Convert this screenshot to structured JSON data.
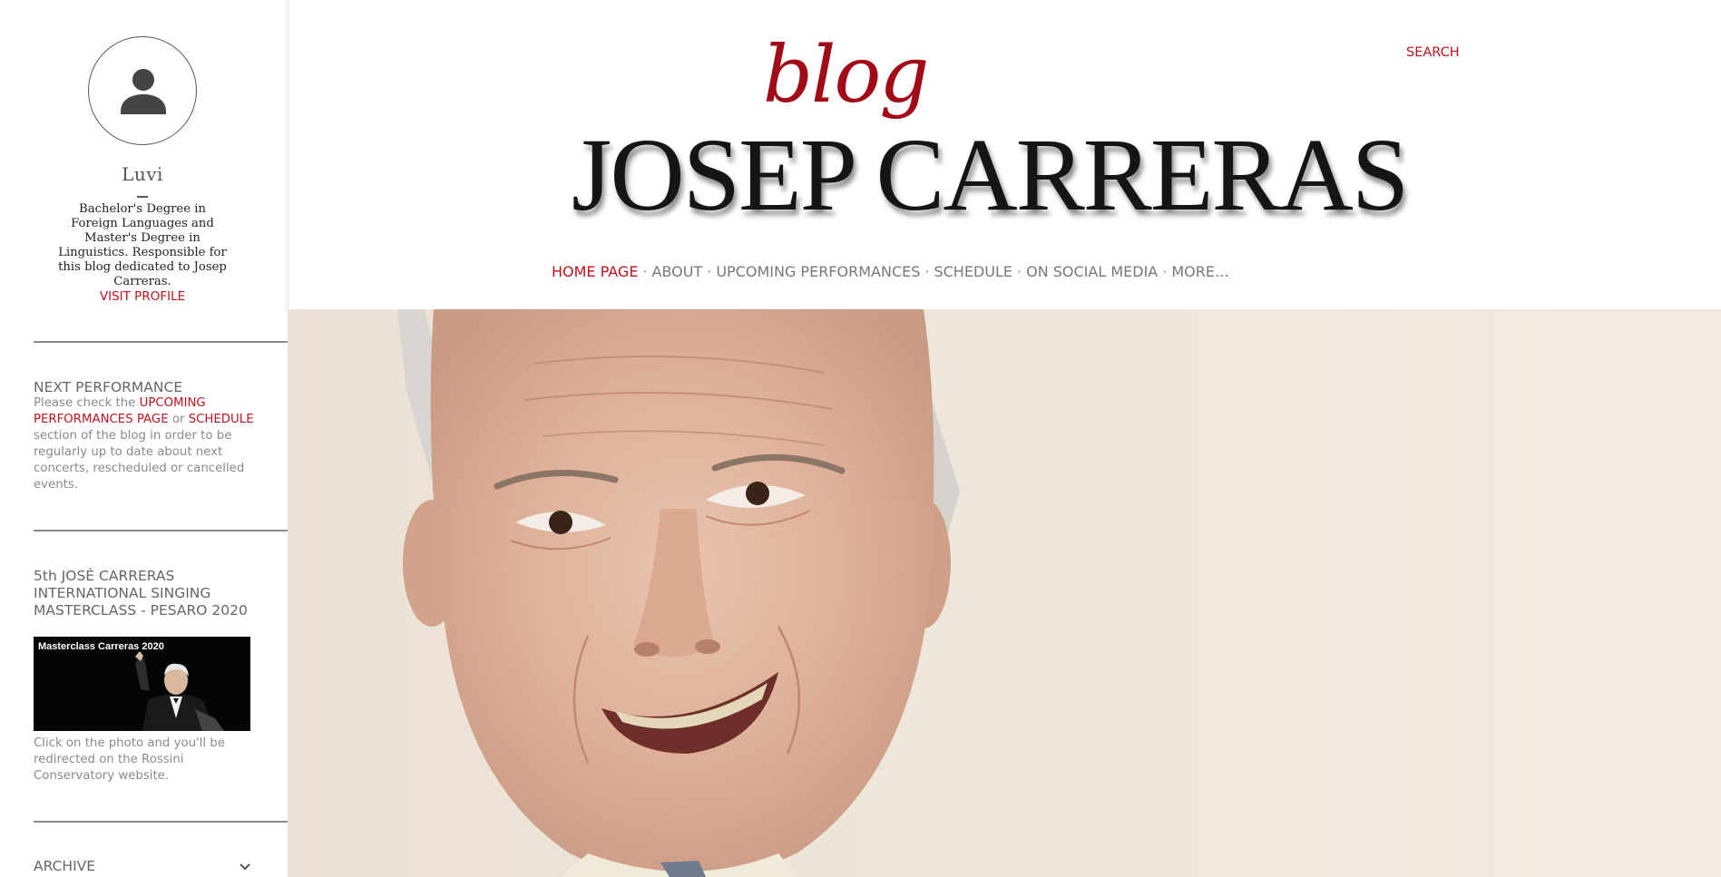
{
  "profile": {
    "name": "Luvi",
    "bio": "Bachelor's Degree in Foreign Languages and Master's Degree in Linguistics. Responsible for this blog dedicated to Josep Carreras.",
    "visit_label": "VISIT PROFILE"
  },
  "widgets": {
    "next_performance": {
      "title": "NEXT PERFORMANCE",
      "text_1": "Please check the ",
      "link_1": "UPCOMING PERFORMANCES PAGE",
      "text_2": " or ",
      "link_2": "SCHEDULE",
      "text_3": " section of the blog in order to be regularly up to date about next concerts, rescheduled or cancelled events."
    },
    "masterclass": {
      "title": "5th JOSÉ CARRERAS INTERNATIONAL SINGING MASTERCLASS - PESARO 2020",
      "image_caption": "Masterclass Carreras 2020",
      "text": "Click on the photo and you'll be redirected on the Rossini Conservatory website."
    },
    "archive": {
      "title": "ARCHIVE"
    }
  },
  "header": {
    "search_label": "SEARCH",
    "logo_blog": "blog",
    "logo_title": "JOSEP CARRERAS"
  },
  "nav": {
    "items": [
      "HOME PAGE",
      "ABOUT",
      "UPCOMING PERFORMANCES",
      "SCHEDULE",
      "ON SOCIAL MEDIA",
      "MORE…"
    ],
    "separator": "·"
  },
  "colors": {
    "accent": "#c0131d",
    "logo_blog": "#a10a16",
    "text_gray": "#777777",
    "hero_bg": "#ede4d9"
  },
  "icons": {
    "avatar": "person-icon",
    "archive": "chevron-down-icon"
  }
}
